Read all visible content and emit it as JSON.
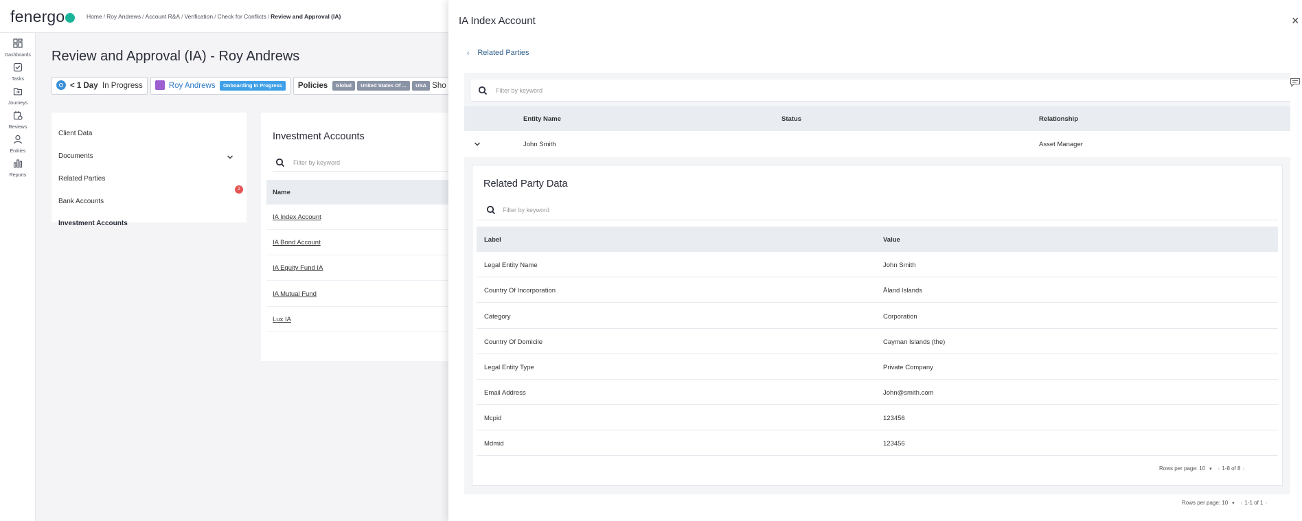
{
  "header": {
    "logo_text": "fenergo",
    "breadcrumb": [
      "Home",
      "Roy Andrews",
      "Account R&A",
      "Verification",
      "Check for Conflicts"
    ],
    "breadcrumb_current": "Review and Approval (IA)"
  },
  "nav": {
    "items": [
      {
        "label": "Dashboards",
        "icon": "dashboard-icon"
      },
      {
        "label": "Tasks",
        "icon": "tasks-icon"
      },
      {
        "label": "Journeys",
        "icon": "journeys-icon"
      },
      {
        "label": "Reviews",
        "icon": "reviews-icon"
      },
      {
        "label": "Entities",
        "icon": "entities-icon"
      },
      {
        "label": "Reports",
        "icon": "reports-icon"
      }
    ]
  },
  "page": {
    "title": "Review and Approval (IA) - Roy Andrews",
    "chip_time": "< 1 Day",
    "chip_status": "In Progress",
    "chip_entity": "Roy Andrews",
    "chip_entity_tag": "Onboarding In Progress",
    "policies_label": "Policies",
    "policy_tags": [
      "Global",
      "United States Of ...",
      "USA"
    ],
    "policies_more": "Sho"
  },
  "side_menu": {
    "items": [
      "Client Data",
      "Documents",
      "Related Parties",
      "Bank Accounts",
      "Investment Accounts"
    ],
    "bank_badge": "2"
  },
  "investment_accounts": {
    "title": "Investment Accounts",
    "filter_placeholder": "Filter by keyword",
    "column": "Name",
    "rows": [
      "IA Index Account",
      "IA Bond Account",
      "IA Equity Fund IA",
      "IA Mutual Fund",
      "Lux IA"
    ]
  },
  "panel": {
    "title": "IA Index Account",
    "close_label": "×",
    "back_label": "Related Parties",
    "filter_placeholder": "Filter by keyword",
    "columns": {
      "entity_name": "Entity Name",
      "status": "Status",
      "relationship": "Relationship"
    },
    "row": {
      "entity_name": "John Smith",
      "status": "",
      "relationship": "Asset Manager"
    },
    "pager": {
      "rows_per_page": "Rows per page: 10",
      "range": "1-1 of 1"
    }
  },
  "related_party_data": {
    "title": "Related Party Data",
    "filter_placeholder": "Filter by keyword",
    "columns": {
      "label": "Label",
      "value": "Value"
    },
    "rows": [
      {
        "label": "Legal Entity Name",
        "value": "John Smith"
      },
      {
        "label": "Country Of Incorporation",
        "value": "Åland Islands"
      },
      {
        "label": "Category",
        "value": "Corporation"
      },
      {
        "label": "Country Of Domicile",
        "value": "Cayman Islands (the)"
      },
      {
        "label": "Legal Entity Type",
        "value": "Private Company"
      },
      {
        "label": "Email Address",
        "value": "John@smith.com"
      },
      {
        "label": "Mcpid",
        "value": "123456"
      },
      {
        "label": "Mdmid",
        "value": "123456"
      }
    ],
    "pager": {
      "rows_per_page": "Rows per page: 10",
      "range": "1-8 of 8"
    }
  },
  "colors": {
    "accent": "#3b8fd9",
    "brand": "#1bb39a",
    "badge": "#e55353"
  }
}
